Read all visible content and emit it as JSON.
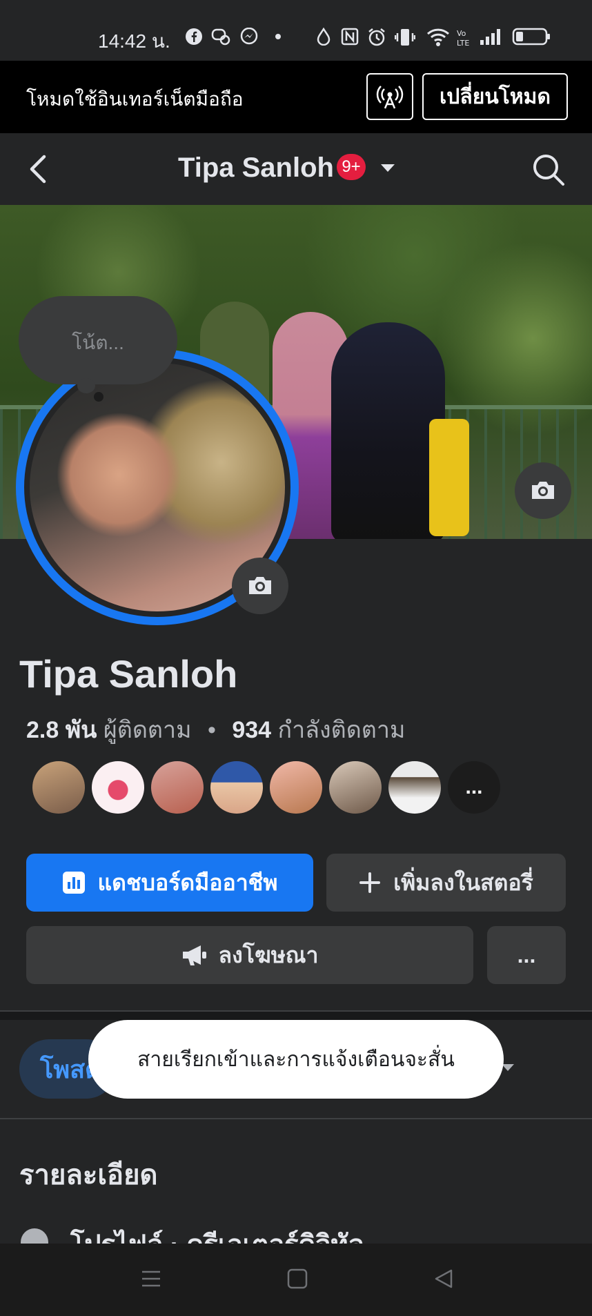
{
  "status_bar": {
    "time": "14:42 น."
  },
  "data_banner": {
    "message": "โหมดใช้อินเทอร์เน็ตมือถือ",
    "switch_label": "เปลี่ยนโหมด"
  },
  "navbar": {
    "title": "Tipa Sanloh",
    "badge": "9+"
  },
  "note": {
    "placeholder": "โน้ต..."
  },
  "profile": {
    "name": "Tipa Sanloh",
    "followers_count": "2.8 พัน",
    "followers_label": "ผู้ติดตาม",
    "separator": "•",
    "following_count": "934",
    "following_label": "กำลังติดตาม",
    "more_friends": "..."
  },
  "actions": {
    "dashboard": "แดชบอร์ดมืออาชีพ",
    "add_story": "เพิ่มลงในสตอรี่",
    "advertise": "ลงโฆษณา",
    "more": "..."
  },
  "tabs": {
    "posts": "โพสต์"
  },
  "toast": {
    "message": "สายเรียกเข้าและการแจ้งเตือนจะสั่น"
  },
  "details": {
    "title": "รายละเอียด",
    "row": "โปรไฟล์ · ครีเอเตอร์ดิจิทัล"
  },
  "colors": {
    "accent": "#1877f2",
    "background": "#242526",
    "surface": "#3a3b3c",
    "badge": "#e41e3f"
  }
}
